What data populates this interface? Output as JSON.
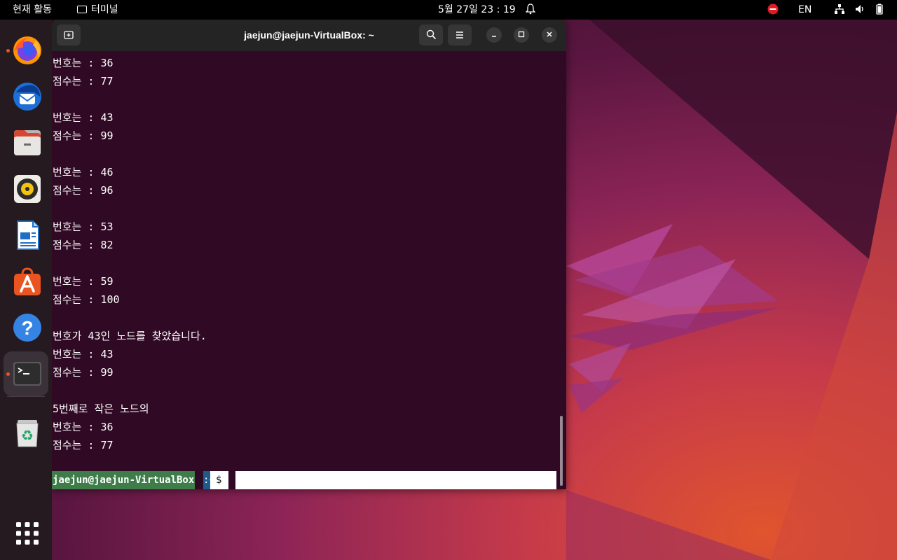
{
  "topbar": {
    "activities": "현재 활동",
    "app_name": "터미널",
    "clock": "5월 27일  23 : 19",
    "lang": "EN"
  },
  "dock": {
    "apps": [
      "firefox-icon",
      "thunderbird-icon",
      "files-icon",
      "rhythmbox-icon",
      "writer-icon",
      "software-icon",
      "help-icon",
      "terminal-icon",
      "trash-icon",
      "app-grid-icon"
    ]
  },
  "terminal": {
    "title": "jaejun@jaejun-VirtualBox: ~",
    "lines": [
      "번호는 : 36",
      "점수는 : 77",
      "",
      "번호는 : 43",
      "점수는 : 99",
      "",
      "번호는 : 46",
      "점수는 : 96",
      "",
      "번호는 : 53",
      "점수는 : 82",
      "",
      "번호는 : 59",
      "점수는 : 100",
      "",
      "번호가 43인 노드를 찾았습니다.",
      "번호는 : 43",
      "점수는 : 99",
      "",
      "5번째로 작은 노드의",
      "번호는 : 36",
      "점수는 : 77"
    ],
    "prompt_user": "jaejun@jaejun-VirtualBox",
    "prompt_colon": ":~",
    "prompt_dollar": "$"
  },
  "colors": {
    "terminal_bg": "#300a24",
    "titlebar_bg": "#242424",
    "accent": "#e95420",
    "prompt_green": "#3e7d4a"
  }
}
